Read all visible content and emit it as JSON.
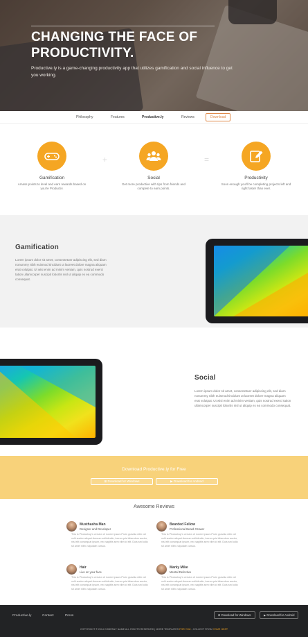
{
  "hero": {
    "title": "CHANGING THE FACE OF PRODUCTIVITY.",
    "subtitle": "Productive.ly is a game-changing productivity app that utilizes gamification and social influence to get you working."
  },
  "nav": {
    "items": [
      "Philosophy",
      "Features",
      "Productive.ly",
      "Reviews"
    ],
    "download": "Download"
  },
  "features": [
    {
      "icon": "gamepad-icon",
      "title": "Gamification",
      "text": "Amass points to level and earn rewards based on you're Productiv."
    },
    {
      "icon": "users-icon",
      "title": "Social",
      "text": "Get more productive with tips from friends and compete to earn points."
    },
    {
      "icon": "edit-icon",
      "title": "Productivity",
      "text": "Soon enough you'll be completing projects left and right faster than ever."
    }
  ],
  "operators": [
    "+",
    "="
  ],
  "gamification": {
    "title": "Gamification",
    "text": "Lorem ipsum dolor sit amet, consectetuer adipiscing elit, sed diam nonummy nibh euismod tincidunt ut laoreet dolore magna aliquam erat volutpat. Ut wisi enim ad minim veniam, quis nostrud exerci tation ullamcorper suscipit lobortis nisl ut aliquip ex ea commodo consequat."
  },
  "social": {
    "title": "Social",
    "text": "Lorem ipsum dolor sit amet, consectetuer adipiscing elit, sed diam nonummy nibh euismod tincidunt ut laoreet dolore magna aliquam erat volutpat. Ut wisi enim ad minim veniam, quis nostrud exerci tation ullamcorper suscipit lobortis nisl ut aliquip ex ea commodo consequat."
  },
  "download_band": {
    "title": "Download Productive.ly for Free",
    "windows": "Download for Windows",
    "android": "Download for Android"
  },
  "reviews": {
    "heading": "Awesome Reviews",
    "items": [
      {
        "name": "Musthasha Man",
        "role": "Designer and Developer",
        "text": "This is Photoshop's version of Lorem Ipsum.Proin gravida nibh vel velit auctor aliquet.Aenean sollicitudin, lorem quis bibendum auctor, nisi elit consequat ipsum, nec sagittis sem nibh id elit. Duis sed odio sit amet nibh vulputate cursus."
      },
      {
        "name": "Bearded Fellow",
        "role": "Professional Beard Grower",
        "text": "This is Photoshop's version of Lorem Ipsum.Proin gravida nibh vel velit auctor aliquet.Aenean sollicitudin, lorem quis bibendum auctor, nisi elit consequat ipsum, nec sagittis sem nibh id elit. Duis sed odio sit amet nibh vulputate cursus."
      },
      {
        "name": "Hair",
        "role": "Live on your face",
        "text": "This is Photoshop's version of Lorem Ipsum.Proin gravida nibh vel velit auctor aliquet.Aenean sollicitudin, lorem quis bibendum auctor, nisi elit consequat ipsum, nec sagittis sem nibh id elit. Duis sed odio sit amet nibh vulputate cursus."
      },
      {
        "name": "Manly Mike",
        "role": "Mental Defective",
        "text": "This is Photoshop's version of Lorem Ipsum.Proin gravida nibh vel velit auctor aliquet.Aenean sollicitudin, lorem quis bibendum auctor, nisi elit consequat ipsum, nec sagittis sem nibh id elit. Duis sed odio sit amet nibh vulputate cursus."
      }
    ]
  },
  "footer": {
    "links": [
      "Productive.ly",
      "Contact",
      "Press"
    ],
    "windows": "Download for Windows",
    "android": "Download for Android",
    "copy_prefix": "COPYRIGHT © 2014 COMPANY NAME ALL RIGHTS RESERVED | MORE TEMPLATES ",
    "copy_highlight1": "FOR YOU",
    "copy_middle": " - COLLECT FROM ",
    "copy_highlight2": "YOUR HOST"
  },
  "colors": {
    "accent": "#f5a623",
    "band": "#f8d27a",
    "footer": "#222325"
  }
}
